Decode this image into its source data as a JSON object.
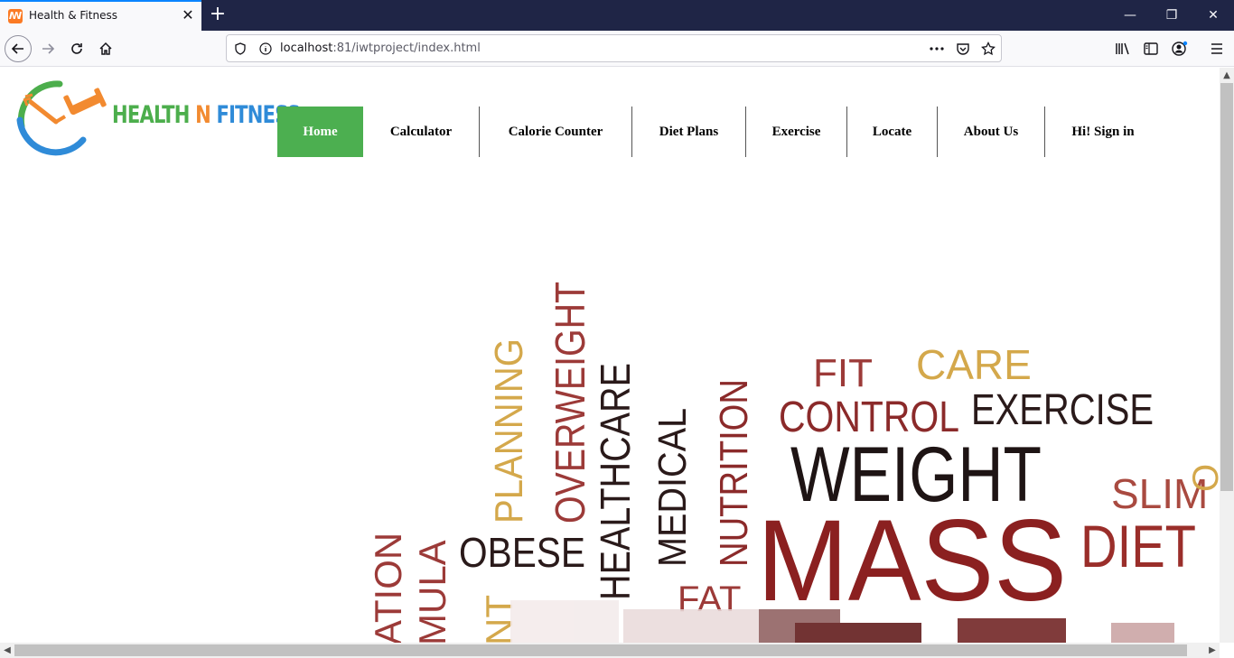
{
  "browser": {
    "tab_title": "Health & Fitness",
    "tab_favicon": "xampp-icon",
    "url_host": "localhost",
    "url_rest": ":81/iwtproject/index.html",
    "new_tab": "+",
    "close": "✕",
    "minimize": "—",
    "restore": "❐",
    "window_close": "✕"
  },
  "logo": {
    "part1": "HEALTH ",
    "part2": "N ",
    "part3": "FITNESS"
  },
  "menu": [
    {
      "label": "Home",
      "active": true
    },
    {
      "label": "Calculator"
    },
    {
      "label": "Calorie Counter"
    },
    {
      "label": "Diet Plans"
    },
    {
      "label": "Exercise"
    },
    {
      "label": "Locate"
    },
    {
      "label": "About Us"
    },
    {
      "label": "Hi! Sign in"
    }
  ],
  "wordcloud": {
    "words": [
      "FIT",
      "CARE",
      "CONTROL",
      "EXERCISE",
      "WEIGHT",
      "SLIM",
      "MASS",
      "DIET",
      "OBESE",
      "FAT",
      "PLANNING",
      "OVERWEIGHT",
      "HEALTHCARE",
      "MEDICAL",
      "NUTRITION",
      "ATION",
      "MULA",
      "NT"
    ]
  },
  "colors": {
    "accent_green": "#4caf50",
    "word_red": "#8b2020",
    "word_gold": "#d4a84b",
    "word_dark": "#222222"
  }
}
